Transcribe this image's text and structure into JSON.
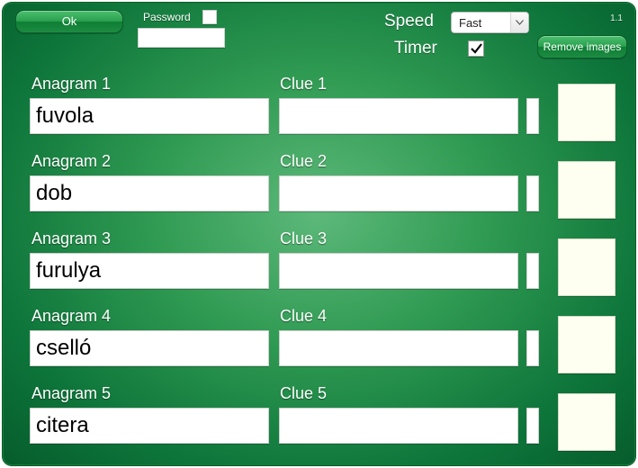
{
  "toolbar": {
    "ok_label": "Ok",
    "password_label": "Password",
    "password_checked": false,
    "password_value": "",
    "speed_label": "Speed",
    "speed_value": "Fast",
    "timer_label": "Timer",
    "timer_checked": true,
    "remove_label": "Remove images",
    "version": "1.1"
  },
  "labels": {
    "anagram_prefix": "Anagram",
    "clue_prefix": "Clue"
  },
  "rows": [
    {
      "n": 1,
      "anagram": "fuvola",
      "clue": ""
    },
    {
      "n": 2,
      "anagram": "dob",
      "clue": ""
    },
    {
      "n": 3,
      "anagram": "furulya",
      "clue": ""
    },
    {
      "n": 4,
      "anagram": "cselló",
      "clue": ""
    },
    {
      "n": 5,
      "anagram": "citera",
      "clue": ""
    }
  ]
}
